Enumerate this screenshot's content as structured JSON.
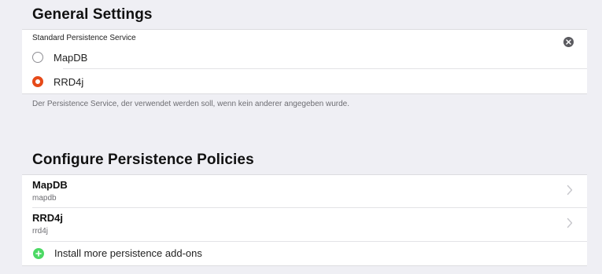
{
  "general": {
    "title": "General Settings",
    "field_label": "Standard Persistence Service",
    "options": [
      {
        "label": "MapDB",
        "selected": false
      },
      {
        "label": "RRD4j",
        "selected": true
      }
    ],
    "footer_note": "Der Persistence Service, der verwendet werden soll, wenn kein anderer angegeben wurde."
  },
  "policies": {
    "title": "Configure Persistence Policies",
    "items": [
      {
        "title": "MapDB",
        "subtitle": "mapdb"
      },
      {
        "title": "RRD4j",
        "subtitle": "rrd4j"
      }
    ],
    "install_label": "Install more persistence add-ons"
  },
  "colors": {
    "accent": "#e64a19",
    "add": "#4cd964",
    "background": "#efeff4"
  },
  "icons": {
    "clear": "clear-icon",
    "chevron": "chevron-right-icon",
    "add": "plus-circle-icon"
  }
}
